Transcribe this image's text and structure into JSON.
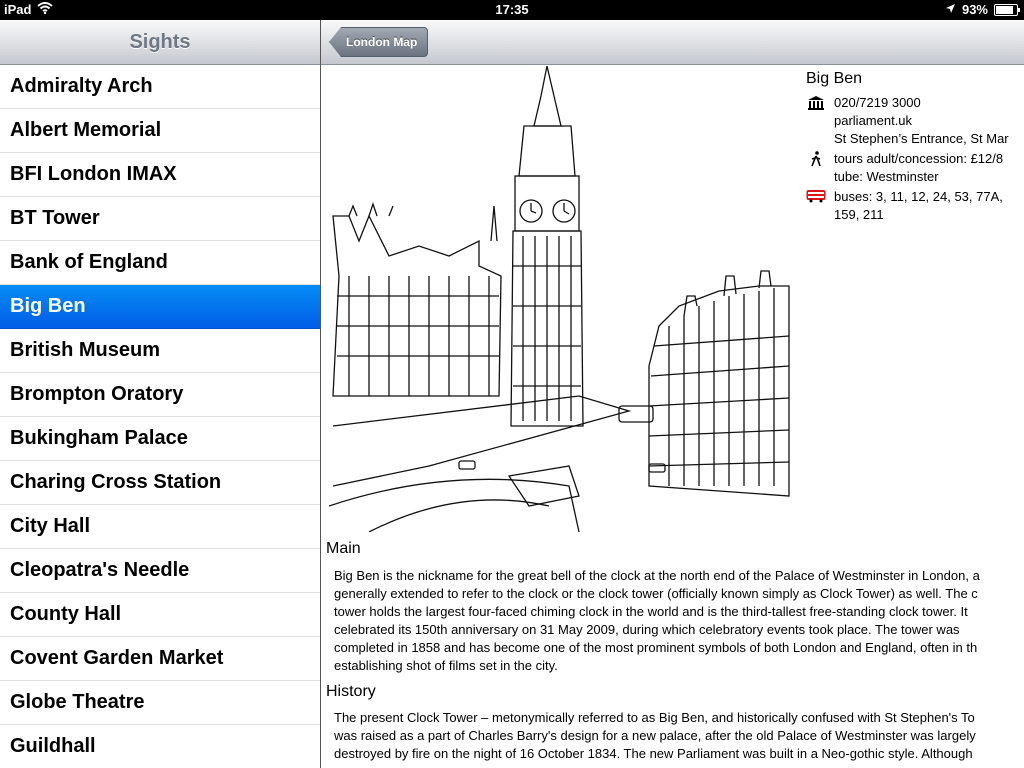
{
  "status": {
    "device": "iPad",
    "time": "17:35",
    "battery": "93%",
    "battery_level": 0.93
  },
  "sidebar": {
    "title": "Sights",
    "items": [
      {
        "label": "Admiralty Arch",
        "selected": false
      },
      {
        "label": "Albert Memorial",
        "selected": false
      },
      {
        "label": "BFI London IMAX",
        "selected": false
      },
      {
        "label": "BT Tower",
        "selected": false
      },
      {
        "label": "Bank of England",
        "selected": false
      },
      {
        "label": "Big Ben",
        "selected": true
      },
      {
        "label": "British Museum",
        "selected": false
      },
      {
        "label": "Brompton Oratory",
        "selected": false
      },
      {
        "label": "Bukingham Palace",
        "selected": false
      },
      {
        "label": "Charing Cross Station",
        "selected": false
      },
      {
        "label": "City Hall",
        "selected": false
      },
      {
        "label": "Cleopatra's Needle",
        "selected": false
      },
      {
        "label": "County Hall",
        "selected": false
      },
      {
        "label": "Covent Garden Market",
        "selected": false
      },
      {
        "label": "Globe Theatre",
        "selected": false
      },
      {
        "label": "Guildhall",
        "selected": false
      }
    ]
  },
  "detail": {
    "back_label": "London Map",
    "title": "Big Ben",
    "phone": "020/7219 3000",
    "website": "parliament.uk",
    "address": "St Stephen’s Entrance, St Mar",
    "tours": "tours adult/concession: £12/8",
    "tube": "tube: Westminster",
    "buses_line1": "buses: 3, 11, 12, 24, 53, 77A,",
    "buses_line2": "159, 211",
    "sections": [
      {
        "title": "Main",
        "lines": [
          "Big Ben is the nickname for the great bell of the clock at the north end of the Palace of Westminster in London, a",
          "generally extended to refer to the clock or the clock tower (officially known simply as Clock Tower) as well. The c",
          "tower holds the largest four-faced chiming clock in the world and is the third-tallest free-standing clock tower. It",
          "celebrated its 150th anniversary on 31 May 2009, during which celebratory events took place. The tower was",
          "completed in 1858 and has become one of the most prominent symbols of both London and England, often in th",
          "establishing shot of films set in the city."
        ]
      },
      {
        "title": "History",
        "lines": [
          "The present Clock Tower – metonymically referred to as Big Ben, and historically confused with St Stephen's To",
          "was raised as a part of Charles Barry's design for a new palace, after the old Palace of Westminster was largely",
          "destroyed by fire on the night of 16 October 1834. The new Parliament was built in a Neo-gothic style. Although",
          "…"
        ]
      }
    ]
  }
}
